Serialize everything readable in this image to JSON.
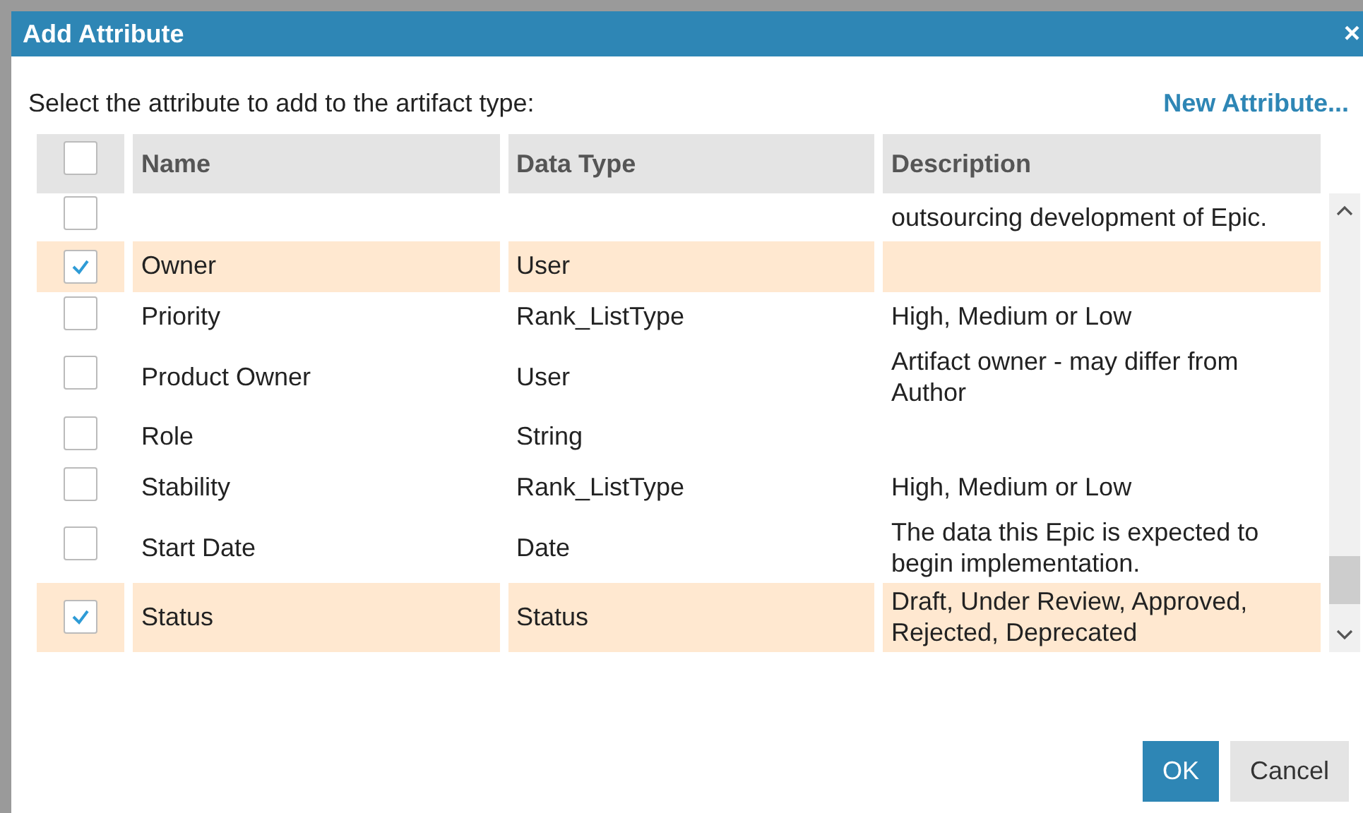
{
  "dialog": {
    "title": "Add Attribute",
    "close": "×"
  },
  "instruction": "Select the attribute to add to the artifact type:",
  "new_attribute_link": "New Attribute...",
  "table": {
    "select_all_checked": false,
    "columns": [
      "Name",
      "Data Type",
      "Description"
    ],
    "rows": [
      {
        "checked": false,
        "description": "outsourcing development of Epic."
      },
      {
        "checked": true,
        "name": "Owner",
        "data_type": "User"
      },
      {
        "checked": false,
        "name": "Priority",
        "data_type": "Rank_ListType",
        "description": "High, Medium or Low"
      },
      {
        "checked": false,
        "name": "Product Owner",
        "data_type": "User",
        "description": "Artifact owner - may differ from Author"
      },
      {
        "checked": false,
        "name": "Role",
        "data_type": "String"
      },
      {
        "checked": false,
        "name": "Stability",
        "data_type": "Rank_ListType",
        "description": "High, Medium or Low"
      },
      {
        "checked": false,
        "name": "Start Date",
        "data_type": "Date",
        "description": "The data this Epic is expected to begin implementation."
      },
      {
        "checked": true,
        "name": "Status",
        "data_type": "Status",
        "description": "Draft, Under Review, Approved, Rejected, Deprecated"
      }
    ]
  },
  "buttons": [
    {
      "label": "OK",
      "kind": "primary"
    },
    {
      "label": "Cancel",
      "kind": "secondary"
    }
  ]
}
